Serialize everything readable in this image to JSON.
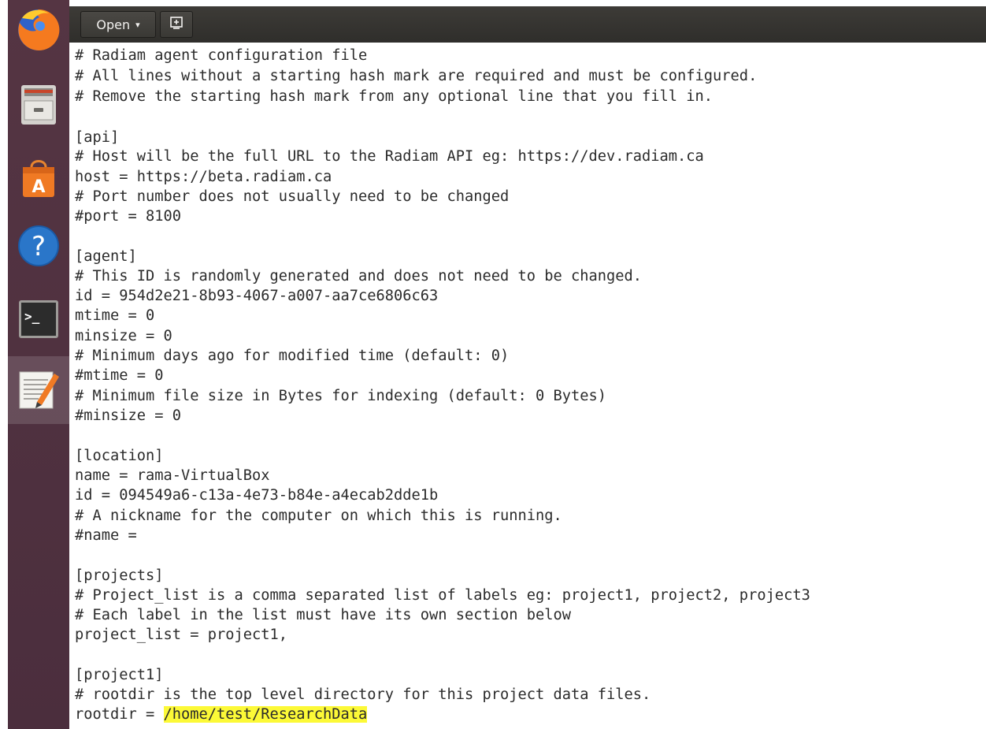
{
  "toolbar": {
    "open_label": "Open",
    "open_caret": "▾",
    "new_icon": "new-document-icon"
  },
  "launcher": {
    "items": [
      {
        "name": "firefox-icon"
      },
      {
        "name": "files-icon"
      },
      {
        "name": "software-center-icon"
      },
      {
        "name": "help-icon"
      },
      {
        "name": "terminal-icon"
      },
      {
        "name": "text-editor-icon",
        "active": true
      }
    ]
  },
  "editor": {
    "lines": [
      "# Radiam agent configuration file",
      "# All lines without a starting hash mark are required and must be configured.",
      "# Remove the starting hash mark from any optional line that you fill in.",
      "",
      "[api]",
      "# Host will be the full URL to the Radiam API eg: https://dev.radiam.ca",
      "host = https://beta.radiam.ca",
      "# Port number does not usually need to be changed",
      "#port = 8100",
      "",
      "[agent]",
      "# This ID is randomly generated and does not need to be changed.",
      "id = 954d2e21-8b93-4067-a007-aa7ce6806c63",
      "mtime = 0",
      "minsize = 0",
      "# Minimum days ago for modified time (default: 0)",
      "#mtime = 0",
      "# Minimum file size in Bytes for indexing (default: 0 Bytes)",
      "#minsize = 0",
      "",
      "[location]",
      "name = rama-VirtualBox",
      "id = 094549a6-c13a-4e73-b84e-a4ecab2dde1b",
      "# A nickname for the computer on which this is running.",
      "#name =",
      "",
      "[projects]",
      "# Project_list is a comma separated list of labels eg: project1, project2, project3",
      "# Each label in the list must have its own section below",
      "project_list = project1,",
      "",
      "[project1]",
      "# rootdir is the top level directory for this project data files."
    ],
    "rootdir_prefix": "rootdir = ",
    "rootdir_value": "/home/test/ResearchData",
    "highlight_color": "#fcf937"
  }
}
